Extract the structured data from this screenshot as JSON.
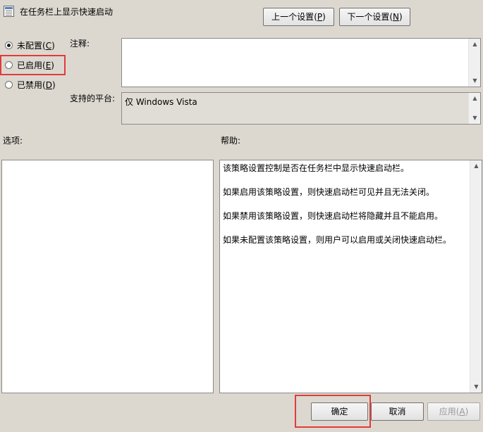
{
  "window": {
    "title": "在任务栏上显示快速启动",
    "title_icon": "policy-setting-icon"
  },
  "nav": {
    "prev_label": "上一个设置",
    "prev_key": "P",
    "next_label": "下一个设置",
    "next_key": "N"
  },
  "state": {
    "options": [
      {
        "label": "未配置",
        "key": "C",
        "checked": true
      },
      {
        "label": "已启用",
        "key": "E",
        "checked": false
      },
      {
        "label": "已禁用",
        "key": "D",
        "checked": false
      }
    ]
  },
  "comment": {
    "label": "注释:",
    "value": ""
  },
  "platform": {
    "label": "支持的平台:",
    "value": "仅 Windows Vista"
  },
  "options_panel": {
    "label": "选项:"
  },
  "help_panel": {
    "label": "帮助:",
    "paragraphs": [
      "该策略设置控制是否在任务栏中显示快速启动栏。",
      "如果启用该策略设置，则快速启动栏可见并且无法关闭。",
      "如果禁用该策略设置，则快速启动栏将隐藏并且不能启用。",
      "如果未配置该策略设置，则用户可以启用或关闭快速启动栏。"
    ]
  },
  "footer": {
    "ok_label": "确定",
    "cancel_label": "取消",
    "apply_label": "应用",
    "apply_key": "A"
  },
  "colors": {
    "highlight": "#e13b3b",
    "background": "#dcd8d0"
  }
}
